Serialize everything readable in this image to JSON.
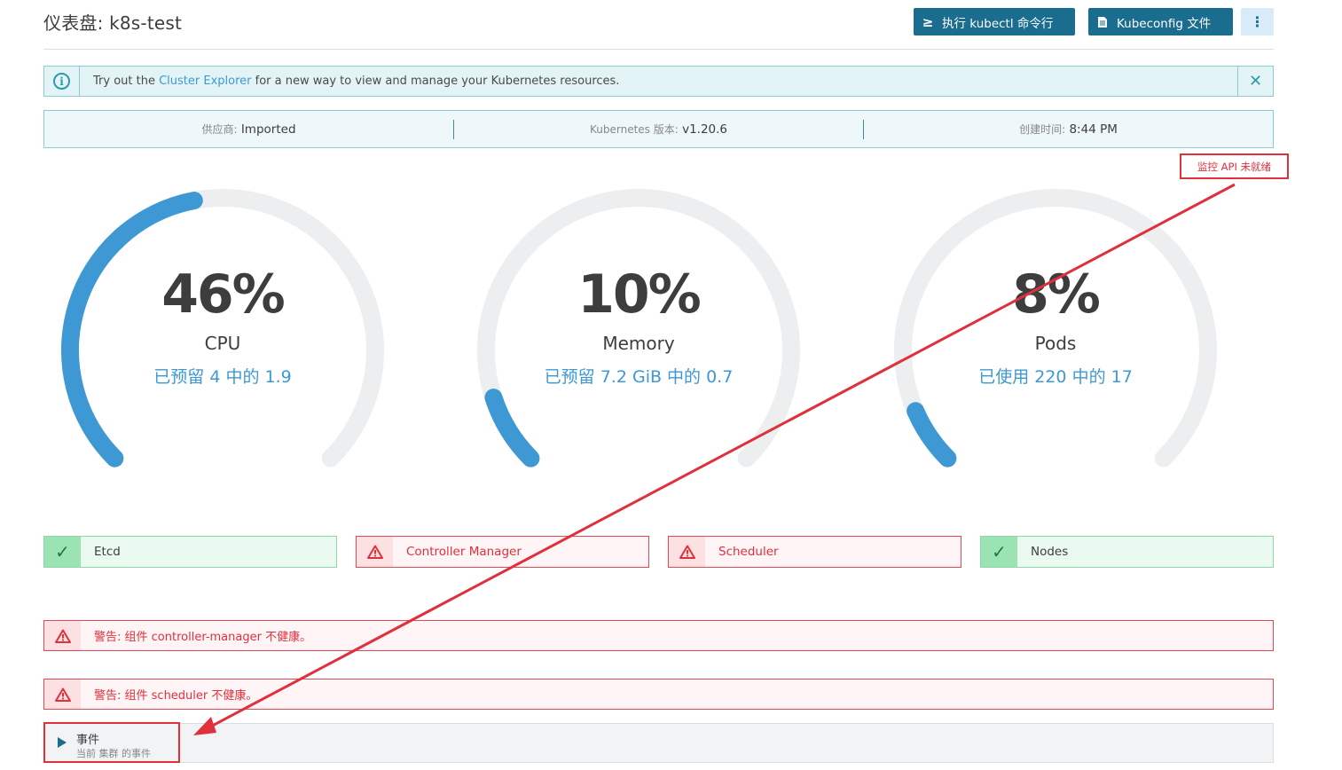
{
  "header": {
    "title": "仪表盘: k8s-test",
    "kubectl_label": "执行 kubectl 命令行",
    "kubectl_icon": "terminal-icon",
    "kubeconfig_label": "Kubeconfig 文件",
    "kubeconfig_icon": "file-icon",
    "more_icon": "vertical-dots-icon"
  },
  "banner": {
    "prefix": "Try out the ",
    "link": "Cluster Explorer",
    "suffix": " for a new way to view and manage your Kubernetes resources.",
    "info_icon_glyph": "i",
    "close_glyph": "✕"
  },
  "info": {
    "provider_label": "供应商:",
    "provider_value": "Imported",
    "version_label": "Kubernetes 版本:",
    "version_value": "v1.20.6",
    "created_label": "创建时间:",
    "created_value": "8:44 PM"
  },
  "monitoring_badge": "监控 API 未就绪",
  "gauges": [
    {
      "value": "46%",
      "name": "CPU",
      "sub": "已预留 4 中的 1.9",
      "fraction": 0.46
    },
    {
      "value": "10%",
      "name": "Memory",
      "sub": "已预留 7.2 GiB 中的 0.7",
      "fraction": 0.1
    },
    {
      "value": "8%",
      "name": "Pods",
      "sub": "已使用 220 中的 17",
      "fraction": 0.08
    }
  ],
  "components": [
    {
      "name": "Etcd",
      "status": "ok"
    },
    {
      "name": "Controller Manager",
      "status": "error"
    },
    {
      "name": "Scheduler",
      "status": "error"
    },
    {
      "name": "Nodes",
      "status": "ok"
    }
  ],
  "warnings": [
    "警告: 组件 controller-manager 不健康。",
    "警告: 组件 scheduler 不健康。"
  ],
  "events": {
    "title": "事件",
    "subtitle": "当前 集群 的事件"
  },
  "colors": {
    "accent": "#3d98d3",
    "primary_button": "#1a6d8f",
    "error": "#e0303b",
    "success": "#9be3b3",
    "gauge_track": "#eceeef"
  }
}
